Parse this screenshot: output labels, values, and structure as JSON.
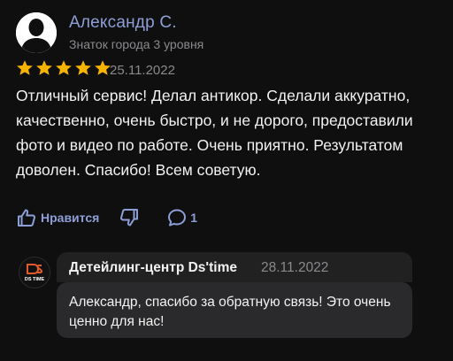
{
  "author": {
    "name": "Александр С.",
    "badge": "Знаток города 3 уровня"
  },
  "rating": {
    "stars": 5,
    "max": 5
  },
  "review": {
    "date": "25.11.2022",
    "text": "Отличный сервис! Делал антикор. Сделали аккуратно, качественно, очень быстро, и не дорого, предоставили фото и видео по работе. Очень приятно. Результатом доволен. Спасибо! Всем советую."
  },
  "actions": {
    "like_label": "Нравится",
    "comment_count": "1"
  },
  "reply": {
    "logo_text": "DS TIME",
    "organization": "Детейлинг-центр Ds'time",
    "date": "28.11.2022",
    "text": "Александр, спасибо за обратную связь! Это очень ценно для нас!"
  },
  "colors": {
    "background": "#0f0f10",
    "accent": "#8e9fd6",
    "star": "#f5b400",
    "muted": "#8a8a8d",
    "reply_bg": "#2a2a2c"
  },
  "icons": [
    "user-avatar-icon",
    "star-icon",
    "thumbs-up-icon",
    "thumbs-down-icon",
    "comment-icon",
    "org-logo-icon"
  ]
}
